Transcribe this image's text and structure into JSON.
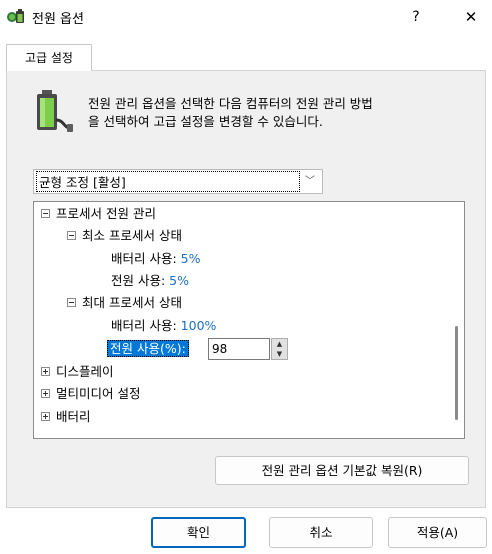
{
  "window": {
    "title": "전원 옵션",
    "help_label": "?",
    "close_label": "✕"
  },
  "tabs": [
    {
      "label": "고급 설정"
    }
  ],
  "description": {
    "line1": "전원 관리 옵션을 선택한 다음 컴퓨터의 전원 관리 방법",
    "line2": "을 선택하여 고급 설정을 변경할 수 있습니다."
  },
  "plan_select": {
    "value": "균형 조정 [활성]",
    "chevron": "﹀"
  },
  "tree": {
    "processor_power": "프로세서 전원 관리",
    "min_state": "최소 프로세서 상태",
    "min_battery_label": "배터리 사용:",
    "min_battery_value": "5%",
    "min_plugged_label": "전원 사용:",
    "min_plugged_value": "5%",
    "max_state": "최대 프로세서 상태",
    "max_battery_label": "배터리 사용:",
    "max_battery_value": "100%",
    "max_plugged_label": "전원 사용(%):",
    "max_plugged_value": "98",
    "display": "디스플레이",
    "multimedia": "멀티미디어 설정",
    "battery": "배터리"
  },
  "buttons": {
    "restore": "전원 관리 옵션 기본값 복원(R)",
    "ok": "확인",
    "cancel": "취소",
    "apply": "적용(A)"
  },
  "colors": {
    "accent": "#0078d7",
    "value_text": "#1f6fc2",
    "ok_border": "#0067c0"
  }
}
